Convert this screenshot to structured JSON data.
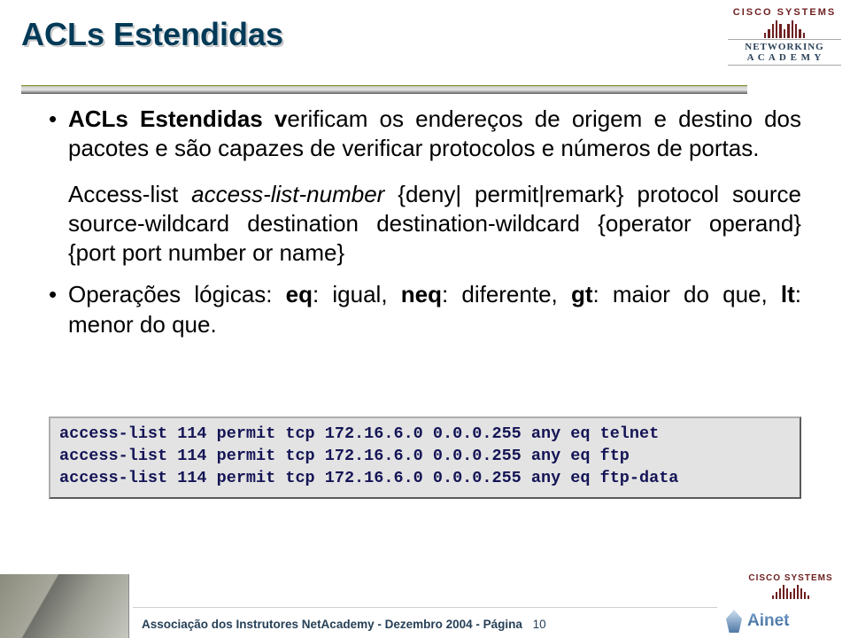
{
  "logo_top": {
    "brand": "CISCO SYSTEMS",
    "sub1": "NETWORKING",
    "sub2": "A C A D E M Y"
  },
  "title": "ACLs Estendidas",
  "bullets": {
    "b1_prefix_bold": "ACLs Estendidas v",
    "b1_rest": "erificam os endereços de origem e destino dos pacotes e são capazes de verificar protocolos e números de portas.",
    "b2_pre": "Operações lógicas: ",
    "b2_eq": "eq",
    "b2_eq_txt": ": igual, ",
    "b2_neq": "neq",
    "b2_neq_txt": ": diferente, ",
    "b2_gt": "gt",
    "b2_gt_txt": ": maior do que, ",
    "b2_lt": "lt",
    "b2_lt_txt": ": menor do que."
  },
  "cmd": {
    "p0": "Access-list ",
    "p1_italic": "access-list-number",
    "p2": " {deny| permit|remark} protocol source source-wildcard destination destination-wildcard {operator operand} {port port number or name}"
  },
  "code": {
    "l1": "access-list 114 permit tcp 172.16.6.0 0.0.0.255 any eq telnet",
    "l2": "access-list 114 permit tcp 172.16.6.0 0.0.0.255 any eq ftp",
    "l3": "access-list 114 permit tcp 172.16.6.0 0.0.0.255 any eq ftp-data"
  },
  "footer": {
    "text": "Associação dos Instrutores NetAcademy - Dezembro 2004 - Página",
    "page": "10",
    "brand_small": "CISCO SYSTEMS",
    "ainet": "Ainet"
  }
}
